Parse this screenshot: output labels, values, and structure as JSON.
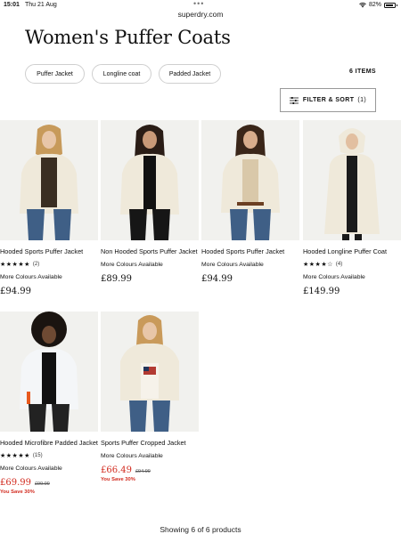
{
  "status": {
    "time": "15:01",
    "date": "Thu 21 Aug",
    "multitask_dots": "•••",
    "battery": "82%",
    "icons": [
      "wifi-icon",
      "battery-icon"
    ]
  },
  "browser": {
    "url": "superdry.com"
  },
  "page": {
    "title": "Women's Puffer Coats",
    "chips": [
      "Puffer Jacket",
      "Longline coat",
      "Padded Jacket"
    ],
    "items_count": "6 ITEMS",
    "filter_label": "FILTER & SORT",
    "filter_count": "(1)"
  },
  "products": [
    {
      "name": "Hooded Sports Puffer Jacket",
      "stars": "★★★★★",
      "reviews": "(2)",
      "colours": "More Colours Available",
      "price": "£94.99"
    },
    {
      "name": "Non Hooded Sports Puffer Jacket",
      "colours": "More Colours Available",
      "price": "£89.99"
    },
    {
      "name": "Hooded Sports Puffer Jacket",
      "colours": "More Colours Available",
      "price": "£94.99"
    },
    {
      "name": "Hooded Longline Puffer Coat",
      "stars": "★★★★☆",
      "reviews": "(4)",
      "colours": "More Colours Available",
      "price": "£149.99"
    },
    {
      "name": "Hooded Microfibre Padded Jacket",
      "stars": "★★★★★",
      "reviews": "(15)",
      "colours": "More Colours Available",
      "price": "£69.99",
      "was": "£99.99",
      "save": "You Save 30%"
    },
    {
      "name": "Sports Puffer Cropped Jacket",
      "colours": "More Colours Available",
      "price": "£66.49",
      "was": "£94.99",
      "save": "You Save 30%"
    }
  ],
  "footer": {
    "showing": "Showing 6 of 6 products"
  },
  "colors": {
    "sale_red": "#d22a1e",
    "image_bg": "#f2f2f0",
    "cream": "#efe9da"
  }
}
